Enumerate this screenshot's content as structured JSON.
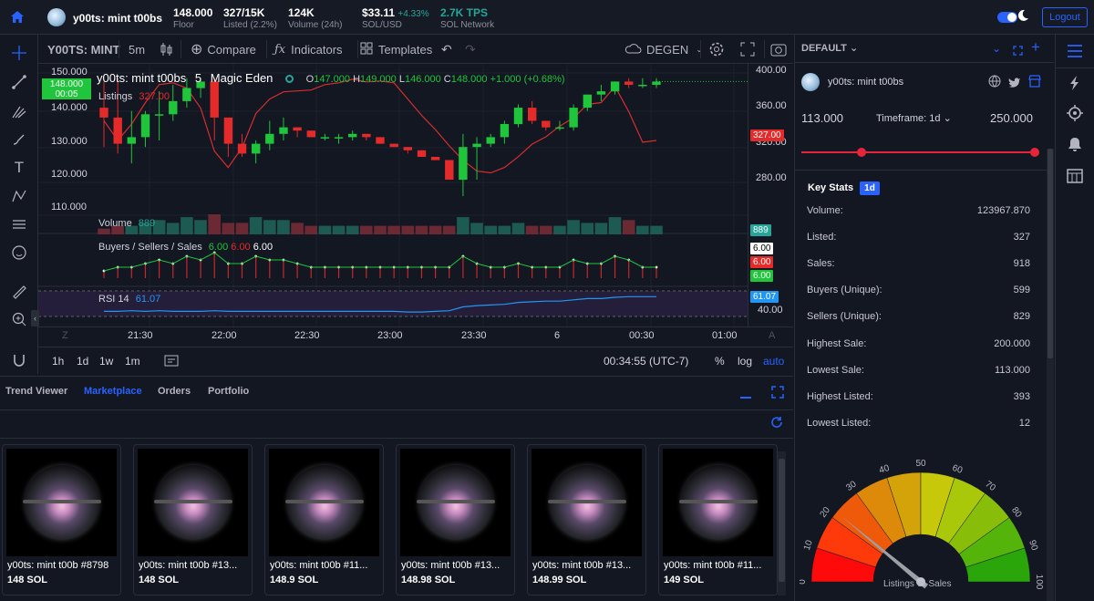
{
  "topbar": {
    "collection": "y00ts: mint t00bs",
    "floor_value": "148.000",
    "floor_label": "Floor",
    "listed_value": "327/15K",
    "listed_label": "Listed (2.2%)",
    "volume_value": "124K",
    "volume_label": "Volume (24h)",
    "sol_value": "$33.11",
    "sol_change": "+4.33%",
    "sol_label": "SOL/USD",
    "tps_value": "2.7K TPS",
    "tps_label": "SOL Network",
    "logout_label": "Logout"
  },
  "toolbar": {
    "symbol": "Y00TS: MINT",
    "interval": "5m",
    "compare": "Compare",
    "indicators": "Indicators",
    "templates": "Templates",
    "mode": "DEGEN"
  },
  "chart": {
    "title": "y00ts: mint t00bs",
    "interval": "5",
    "source": "Magic Eden",
    "o_label": "O",
    "o_value": "147.000",
    "h_label": "H",
    "h_value": "149.000",
    "l_label": "L",
    "l_value": "146.000",
    "c_label": "C",
    "c_value": "148.000",
    "change": "+1.000 (+0.68%)",
    "listings_label": "Listings",
    "listings_value": "327.00",
    "current_price_tag": "148.000",
    "countdown_tag": "00:05",
    "volume_label": "Volume",
    "volume_value": "889",
    "bss_label": "Buyers / Sellers / Sales",
    "bss_b": "6.00",
    "bss_s": "6.00",
    "bss_sales": "6.00",
    "rsi_label": "RSI 14",
    "rsi_value": "61.07",
    "left_ticks": [
      "150.000",
      "140.000",
      "130.000",
      "120.000",
      "110.000"
    ],
    "right_ticks": [
      "400.00",
      "360.00",
      "320.00",
      "280.00"
    ],
    "listings_tag": "327.00",
    "volume_tag": "889",
    "bss_tags": [
      "6.00",
      "6.00",
      "6.00"
    ],
    "rsi_tag": "61.07",
    "rsi_tick": "40.00",
    "time_ticks": [
      "21:30",
      "22:00",
      "22:30",
      "23:00",
      "23:30",
      "6",
      "00:30",
      "01:00"
    ],
    "axis_z": "Z",
    "axis_a": "A"
  },
  "bottom_toolbar": {
    "ranges": [
      "1h",
      "1d",
      "1w",
      "1m"
    ],
    "clock": "00:34:55 (UTC-7)",
    "percent": "%",
    "log": "log",
    "auto": "auto"
  },
  "bottom_panel": {
    "tabs": [
      "Trend Viewer",
      "Marketplace",
      "Orders",
      "Portfolio"
    ],
    "active_tab": 1,
    "cards": [
      {
        "name": "y00ts: mint t00b #8798",
        "price": "148 SOL"
      },
      {
        "name": "y00ts: mint t00b #13...",
        "price": "148 SOL"
      },
      {
        "name": "y00ts: mint t00b #11...",
        "price": "148.9 SOL"
      },
      {
        "name": "y00ts: mint t00b #13...",
        "price": "148.98 SOL"
      },
      {
        "name": "y00ts: mint t00b #13...",
        "price": "148.99 SOL"
      },
      {
        "name": "y00ts: mint t00b #11...",
        "price": "149 SOL"
      }
    ]
  },
  "right_panel": {
    "layout_label": "DEFAULT",
    "collection": "y00ts: mint t00bs",
    "range_min": "113.000",
    "range_max": "250.000",
    "timeframe_label": "Timeframe: 1d",
    "key_stats_label": "Key Stats",
    "key_stats_badge": "1d",
    "stats": [
      {
        "label": "Volume:",
        "value": "123967.870"
      },
      {
        "label": "Listed:",
        "value": "327"
      },
      {
        "label": "Sales:",
        "value": "918"
      },
      {
        "label": "Buyers (Unique):",
        "value": "599"
      },
      {
        "label": "Sellers (Unique):",
        "value": "829"
      },
      {
        "label": "Highest Sale:",
        "value": "200.000"
      },
      {
        "label": "Lowest Sale:",
        "value": "113.000"
      },
      {
        "label": "Highest Listed:",
        "value": "393"
      },
      {
        "label": "Lowest Listed:",
        "value": "12"
      }
    ],
    "gauge_ticks": [
      "0",
      "10",
      "20",
      "30",
      "40",
      "50",
      "60",
      "70",
      "80",
      "90",
      "100"
    ],
    "gauge_value": 22,
    "gauge_label": "Listings vs Sales"
  },
  "chart_data": {
    "type": "candlestick",
    "x": [
      "21:10",
      "21:15",
      "21:20",
      "21:25",
      "21:30",
      "21:35",
      "21:40",
      "21:45",
      "21:50",
      "21:55",
      "22:00",
      "22:05",
      "22:10",
      "22:15",
      "22:20",
      "22:25",
      "22:30",
      "22:35",
      "22:40",
      "22:45",
      "22:50",
      "22:55",
      "23:00",
      "23:05",
      "23:10",
      "23:15",
      "23:20",
      "23:25",
      "23:30",
      "23:35",
      "23:40",
      "23:45",
      "23:50",
      "23:55",
      "00:00",
      "00:05",
      "00:10",
      "00:15",
      "00:20",
      "00:25",
      "00:30"
    ],
    "open": [
      140,
      137,
      129,
      131,
      138,
      138,
      142,
      146,
      148,
      137,
      129,
      126,
      129,
      132,
      134,
      133,
      131,
      131,
      131,
      132,
      131,
      129,
      128,
      127,
      125,
      124,
      118,
      128,
      129,
      131,
      135,
      140,
      136,
      134,
      134,
      140,
      144,
      145,
      148,
      147,
      147
    ],
    "high": [
      148,
      149,
      139,
      139,
      145,
      147,
      149,
      149,
      149,
      137,
      132,
      130,
      136,
      137,
      134,
      133,
      132,
      132,
      133,
      132,
      131,
      129,
      128,
      127,
      125,
      124,
      132,
      131,
      132,
      136,
      141,
      142,
      136,
      136,
      141,
      144,
      147,
      148,
      149,
      149,
      149
    ],
    "low": [
      128,
      126,
      123,
      128,
      130,
      136,
      140,
      143,
      130,
      125,
      125,
      123,
      127,
      130,
      131,
      131,
      130,
      129,
      130,
      130,
      129,
      128,
      126,
      126,
      124,
      118,
      113,
      118,
      128,
      129,
      134,
      135,
      133,
      133,
      133,
      139,
      142,
      144,
      146,
      146,
      146
    ],
    "close": [
      137,
      129,
      131,
      138,
      138,
      142,
      146,
      148,
      137,
      129,
      126,
      129,
      132,
      134,
      133,
      131,
      131,
      131,
      132,
      131,
      129,
      128,
      127,
      125,
      124,
      118,
      128,
      129,
      131,
      135,
      140,
      136,
      134,
      134,
      140,
      144,
      145,
      148,
      147,
      147,
      148
    ],
    "listings": [
      352,
      330,
      348,
      372,
      392,
      394,
      388,
      366,
      318,
      300,
      322,
      360,
      376,
      384,
      385,
      386,
      392,
      394,
      398,
      395,
      396,
      394,
      376,
      358,
      342,
      324,
      308,
      296,
      294,
      300,
      312,
      326,
      334,
      346,
      355,
      370,
      372,
      390,
      362,
      328,
      330
    ],
    "volume": [
      2,
      3,
      3,
      4,
      5,
      4,
      6,
      5,
      7,
      4,
      4,
      6,
      5,
      5,
      4,
      3,
      3,
      3,
      3,
      3,
      3,
      3,
      3,
      3,
      3,
      3,
      6,
      4,
      3,
      3,
      4,
      3,
      3,
      3,
      5,
      4,
      4,
      6,
      5,
      3,
      3
    ],
    "rsi": [
      38,
      38,
      39,
      38,
      39,
      38,
      38,
      38,
      39,
      38,
      38,
      38,
      38,
      38,
      38,
      38,
      38,
      38,
      38,
      38,
      38,
      38,
      37,
      37,
      38,
      39,
      45,
      47,
      48,
      49,
      52,
      53,
      54,
      54,
      56,
      58,
      58,
      60,
      61,
      61,
      61
    ],
    "ylim_price": [
      108,
      152
    ],
    "ylim_listings": [
      250,
      410
    ],
    "legend": "top-left"
  }
}
